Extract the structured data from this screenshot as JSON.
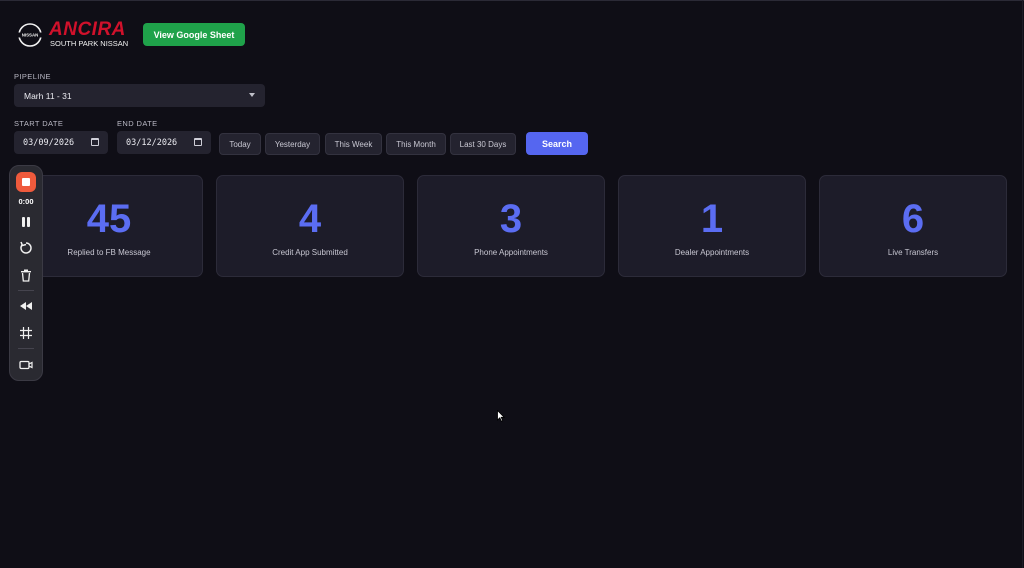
{
  "brand": {
    "badge_text": "NISSAN",
    "name": "ANCIRA",
    "subtitle": "SOUTH PARK NISSAN",
    "brand_red": "#d0112b"
  },
  "header": {
    "sheet_button": "View Google Sheet",
    "sheet_button_color": "#1fa24a"
  },
  "filters": {
    "pipeline_label": "PIPELINE",
    "pipeline_value": "Marh 11 - 31",
    "start_label": "START DATE",
    "start_value": "03/09/2026",
    "end_label": "END DATE",
    "end_value": "03/12/2026",
    "quick_ranges": [
      "Today",
      "Yesterday",
      "This Week",
      "This Month",
      "Last 30 Days"
    ],
    "search_button": "Search",
    "accent": "#5566f0"
  },
  "metrics": [
    {
      "value": "45",
      "label": "Replied to FB Message"
    },
    {
      "value": "4",
      "label": "Credit App Submitted"
    },
    {
      "value": "3",
      "label": "Phone Appointments"
    },
    {
      "value": "1",
      "label": "Dealer Appointments"
    },
    {
      "value": "6",
      "label": "Live Transfers"
    }
  ],
  "recorder": {
    "time": "0:00",
    "icons": [
      "stop-icon",
      "pause-icon",
      "restart-icon",
      "trash-icon",
      "rewind-icon",
      "grid-icon",
      "camera-icon"
    ]
  }
}
